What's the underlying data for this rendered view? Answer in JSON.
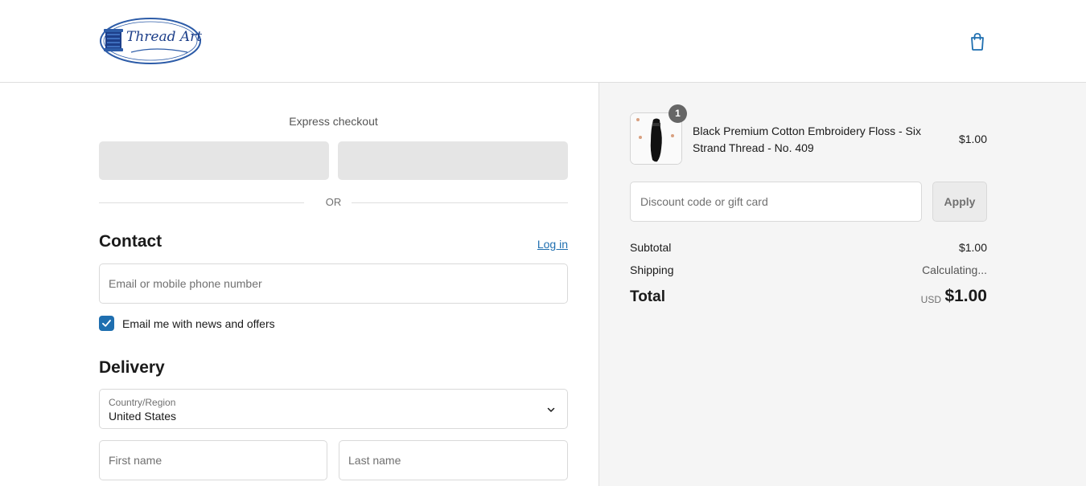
{
  "brand": {
    "logo_text": "Thread Art"
  },
  "header": {
    "cart_icon": "shopping-bag-icon"
  },
  "express": {
    "title": "Express checkout",
    "or_label": "OR"
  },
  "contact": {
    "title": "Contact",
    "login_label": "Log in",
    "email_placeholder": "Email or mobile phone number",
    "newsletter_label": "Email me with news and offers",
    "newsletter_checked": true
  },
  "delivery": {
    "title": "Delivery",
    "country_label": "Country/Region",
    "country_value": "United States",
    "first_name_placeholder": "First name",
    "last_name_placeholder": "Last name"
  },
  "cart": {
    "items": [
      {
        "name": "Black Premium Cotton Embroidery Floss - Six Strand Thread - No. 409",
        "price": "$1.00",
        "quantity": "1"
      }
    ],
    "discount_placeholder": "Discount code or gift card",
    "apply_label": "Apply",
    "subtotal_label": "Subtotal",
    "subtotal_value": "$1.00",
    "shipping_label": "Shipping",
    "shipping_value": "Calculating...",
    "total_label": "Total",
    "total_currency": "USD",
    "total_value": "$1.00"
  },
  "colors": {
    "accent": "#1f6fb0",
    "sidebar_bg": "#f5f5f5",
    "express_btn": "#e5e5e5"
  }
}
